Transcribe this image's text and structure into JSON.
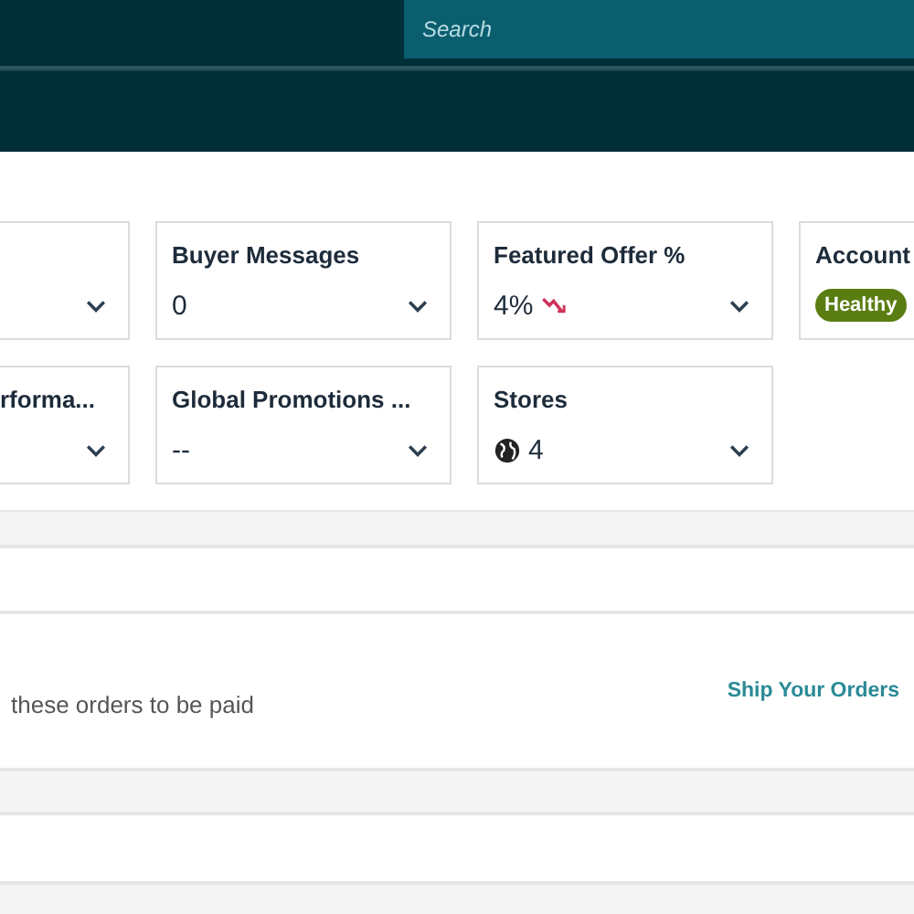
{
  "header": {
    "search": {
      "placeholder": "Search"
    }
  },
  "card_rows": [
    [
      {
        "kind": "blank"
      },
      {
        "kind": "text",
        "title": "Buyer Messages",
        "value": "0"
      },
      {
        "kind": "trend_down",
        "title": "Featured Offer %",
        "value": "4%"
      },
      {
        "kind": "badge",
        "title": "Account",
        "badge": "Healthy"
      }
    ],
    [
      {
        "kind": "text",
        "title": "rforma..."
      },
      {
        "kind": "text",
        "title": "Global Promotions ...",
        "value": "--"
      },
      {
        "kind": "stores",
        "title": "Stores",
        "value": "4"
      }
    ]
  ],
  "orders": {
    "message": "these orders to be paid",
    "link": "Ship Your Orders"
  }
}
